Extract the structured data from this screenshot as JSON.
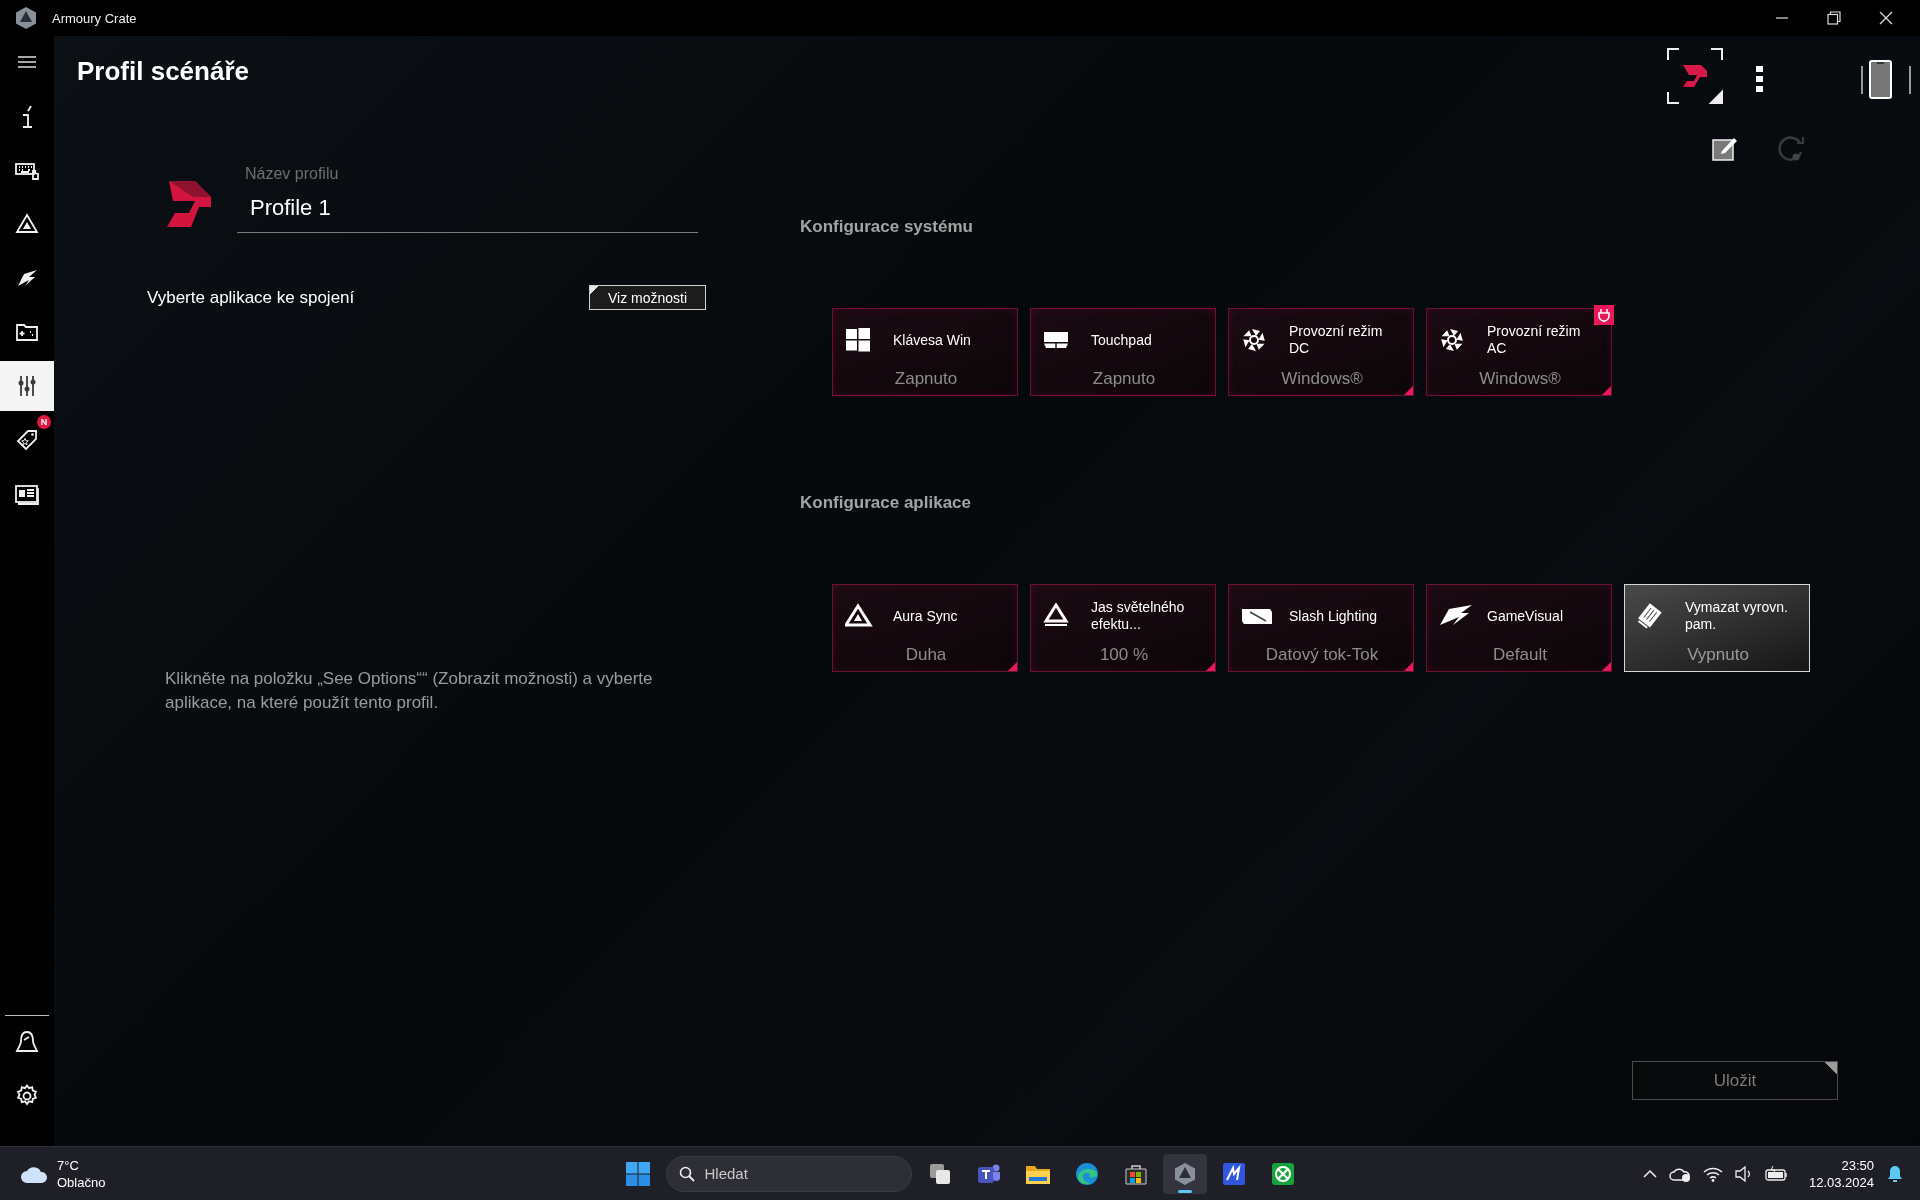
{
  "window": {
    "title": "Armoury Crate"
  },
  "sidebar": {
    "items": [
      {
        "selected": false
      },
      {
        "selected": false
      },
      {
        "selected": false
      },
      {
        "selected": false
      },
      {
        "selected": false
      },
      {
        "selected": true
      },
      {
        "selected": false,
        "badge": "N"
      },
      {
        "selected": false
      }
    ],
    "bottom_items": [
      {
        "selected": false
      },
      {
        "selected": false
      }
    ]
  },
  "page": {
    "title": "Profil scénáře"
  },
  "profile": {
    "name_label": "Název profilu",
    "name_value": "Profile 1",
    "apps_label": "Vyberte aplikace ke spojení",
    "see_options_button": "Viz možnosti",
    "hint": "Klikněte na položku „See Options““ (Zobrazit možnosti) a vyberte aplikace, na které použít tento profil."
  },
  "system_config": {
    "title": "Konfigurace systému",
    "tiles": [
      {
        "title": "Klávesa Win",
        "value": "Zapnuto",
        "has_options": false,
        "power_badge": false,
        "selected": false
      },
      {
        "title": "Touchpad",
        "value": "Zapnuto",
        "has_options": false,
        "power_badge": false,
        "selected": false
      },
      {
        "title": "Provozní režim DC",
        "value": "Windows®",
        "has_options": true,
        "power_badge": false,
        "selected": false
      },
      {
        "title": "Provozní režim AC",
        "value": "Windows®",
        "has_options": true,
        "power_badge": true,
        "selected": false
      }
    ]
  },
  "app_config": {
    "title": "Konfigurace aplikace",
    "tiles": [
      {
        "title": "Aura Sync",
        "value": "Duha",
        "has_options": true,
        "power_badge": false,
        "selected": false
      },
      {
        "title": "Jas světelného efektu...",
        "value": "100 %",
        "has_options": true,
        "power_badge": false,
        "selected": false
      },
      {
        "title": "Slash Lighting",
        "value": "Datový tok-Tok",
        "has_options": true,
        "power_badge": false,
        "selected": false
      },
      {
        "title": "GameVisual",
        "value": "Default",
        "has_options": true,
        "power_badge": false,
        "selected": false
      },
      {
        "title": "Vymazat vyrovn. pam.",
        "value": "Vypnuto",
        "has_options": false,
        "power_badge": false,
        "selected": true
      }
    ]
  },
  "save_button": {
    "label": "Uložit",
    "disabled": true
  },
  "taskbar": {
    "weather": {
      "temperature": "7°C",
      "condition": "Oblačno"
    },
    "search": {
      "placeholder": "Hledat"
    },
    "apps": [
      {
        "active": false
      },
      {
        "active": false
      },
      {
        "active": false
      },
      {
        "active": false
      },
      {
        "active": false
      },
      {
        "active": true
      },
      {
        "active": false
      },
      {
        "active": false
      }
    ],
    "clock": {
      "time": "23:50",
      "date": "12.03.2024"
    }
  }
}
